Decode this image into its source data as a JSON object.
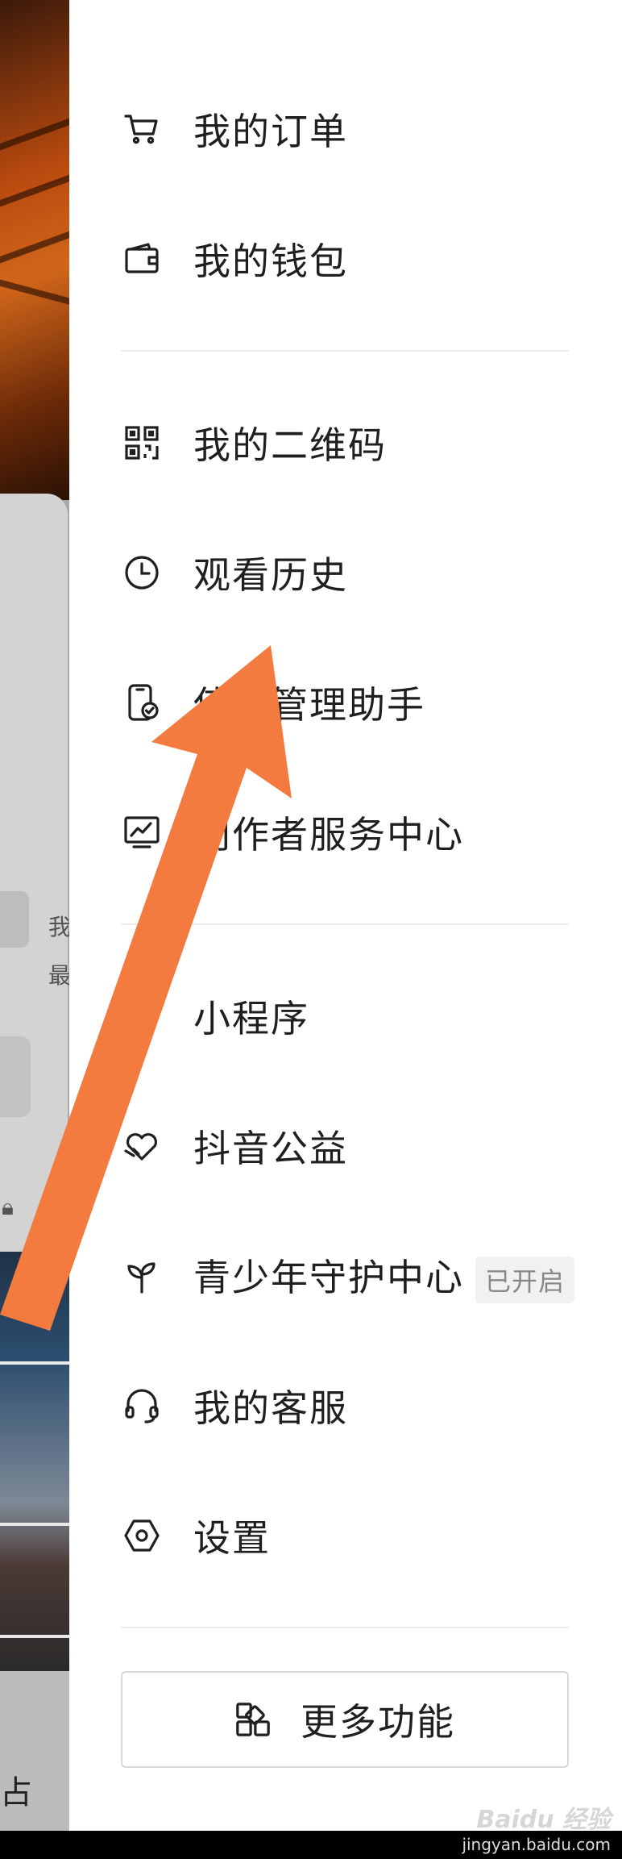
{
  "background": {
    "partial_text_1": "我",
    "partial_text_2": "最",
    "partial_bottom": "占"
  },
  "menu": {
    "items": [
      {
        "key": "orders",
        "label": "我的订单",
        "icon": "cart-icon"
      },
      {
        "key": "wallet",
        "label": "我的钱包",
        "icon": "wallet-icon"
      },
      {
        "key": "qrcode",
        "label": "我的二维码",
        "icon": "qr-code-icon"
      },
      {
        "key": "history",
        "label": "观看历史",
        "icon": "clock-icon"
      },
      {
        "key": "device",
        "label": "使用管理助手",
        "icon": "phone-check-icon"
      },
      {
        "key": "creator",
        "label": "创作者服务中心",
        "icon": "chart-monitor-icon"
      },
      {
        "key": "miniapp",
        "label": "小程序",
        "icon": "asterisk-icon"
      },
      {
        "key": "charity",
        "label": "抖音公益",
        "icon": "heart-hand-icon"
      },
      {
        "key": "youth",
        "label": "青少年守护中心",
        "icon": "sprout-icon",
        "badge": "已开启"
      },
      {
        "key": "support",
        "label": "我的客服",
        "icon": "headset-icon"
      },
      {
        "key": "settings",
        "label": "设置",
        "icon": "hexagon-settings-icon"
      }
    ],
    "more_label": "更多功能"
  },
  "watermark": {
    "brand": "Baidu 经验",
    "url": "jingyan.baidu.com"
  },
  "colors": {
    "arrow": "#F47B40",
    "drawer_bg": "#FFFFFF",
    "text": "#1F1F1F"
  }
}
